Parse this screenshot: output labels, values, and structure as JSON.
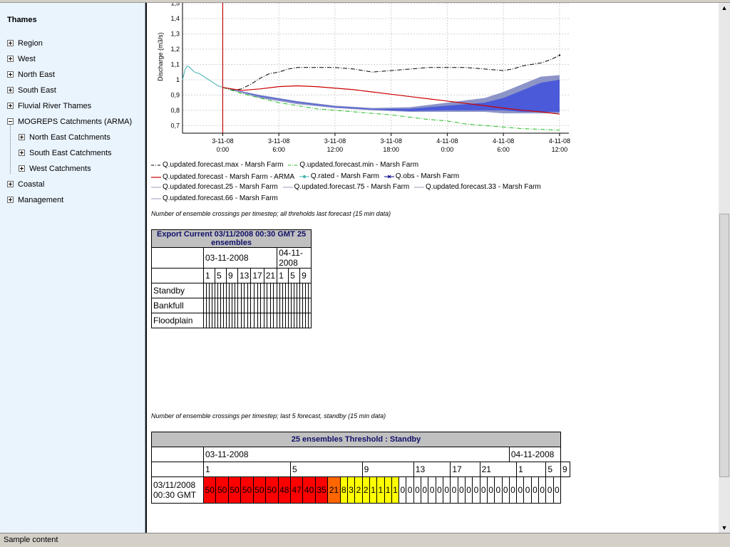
{
  "sidebar": {
    "title": "Thames",
    "items": [
      {
        "label": "Region",
        "expanded": false
      },
      {
        "label": "West",
        "expanded": false
      },
      {
        "label": "North East",
        "expanded": false
      },
      {
        "label": "South East",
        "expanded": false
      },
      {
        "label": "Fluvial River Thames",
        "expanded": false
      },
      {
        "label": "MOGREPS Catchments (ARMA)",
        "expanded": true
      },
      {
        "label": "North East Catchments",
        "expanded": false,
        "child": true
      },
      {
        "label": "South East Catchments",
        "expanded": false,
        "child": true
      },
      {
        "label": "West Catchments",
        "expanded": false,
        "child": true
      },
      {
        "label": "Coastal",
        "expanded": false
      },
      {
        "label": "Management",
        "expanded": false
      }
    ]
  },
  "status": {
    "text": "Sample content"
  },
  "chart_data": {
    "type": "line",
    "ylabel": "Discharge (m3/s)",
    "yticks": [
      "0,7",
      "0,8",
      "0,9",
      "1",
      "1,1",
      "1,2",
      "1,3",
      "1,4",
      "1,5"
    ],
    "ylim": [
      0.65,
      1.55
    ],
    "xticks": [
      {
        "date": "3-11-08",
        "time": "0:00",
        "h": 0
      },
      {
        "date": "3-11-08",
        "time": "6:00",
        "h": 6
      },
      {
        "date": "3-11-08",
        "time": "12:00",
        "h": 12
      },
      {
        "date": "3-11-08",
        "time": "18:00",
        "h": 18
      },
      {
        "date": "4-11-08",
        "time": "0:00",
        "h": 24
      },
      {
        "date": "4-11-08",
        "time": "6:00",
        "h": 30
      },
      {
        "date": "4-11-08",
        "time": "12:00",
        "h": 36
      }
    ],
    "xlim_hours": [
      -4.3,
      37
    ],
    "forecast_time_hours": 0,
    "series": [
      {
        "name": "Q.updated.forecast.max - Marsh Farm",
        "color": "#000000",
        "dash": "6,2,1,2",
        "x": [
          0,
          1,
          2,
          3,
          4,
          5,
          6,
          7,
          8,
          10,
          12,
          14,
          16,
          18,
          20,
          22,
          24,
          26,
          28,
          30,
          31,
          32,
          33,
          34,
          35,
          36
        ],
        "y": [
          0.95,
          0.93,
          0.94,
          0.97,
          1.01,
          1.04,
          1.05,
          1.07,
          1.08,
          1.08,
          1.08,
          1.07,
          1.05,
          1.06,
          1.07,
          1.08,
          1.08,
          1.08,
          1.07,
          1.06,
          1.07,
          1.09,
          1.1,
          1.11,
          1.13,
          1.16
        ]
      },
      {
        "name": "Q.updated.forecast.min - Marsh Farm",
        "color": "#22bb22",
        "dash": "6,2,1,2",
        "x": [
          0,
          2,
          4,
          6,
          8,
          10,
          12,
          14,
          16,
          18,
          20,
          22,
          24,
          26,
          28,
          30,
          32,
          34,
          36
        ],
        "y": [
          0.95,
          0.91,
          0.88,
          0.85,
          0.83,
          0.81,
          0.8,
          0.79,
          0.78,
          0.77,
          0.755,
          0.74,
          0.73,
          0.71,
          0.7,
          0.69,
          0.68,
          0.675,
          0.67
        ]
      },
      {
        "name": "Q.updated.forecast - Marsh Farm - ARMA",
        "color": "#cc0000",
        "dash": "",
        "x": [
          0,
          2,
          4,
          6,
          8,
          10,
          12,
          14,
          16,
          18,
          20,
          22,
          24,
          26,
          28,
          30,
          32,
          34,
          36
        ],
        "y": [
          0.95,
          0.93,
          0.94,
          0.955,
          0.96,
          0.955,
          0.945,
          0.935,
          0.92,
          0.905,
          0.89,
          0.875,
          0.86,
          0.845,
          0.83,
          0.815,
          0.8,
          0.79,
          0.775
        ]
      },
      {
        "name": "Q.rated - Marsh Farm",
        "color": "#40b0b0",
        "dash": "",
        "x": [
          -4.3,
          -4.0,
          -3.8,
          -3.5,
          -3.2,
          -3.0,
          -2.5,
          -2.0,
          -1.5,
          -1.0,
          -0.5,
          0
        ],
        "y": [
          1.0,
          1.07,
          1.09,
          1.08,
          1.06,
          1.05,
          1.04,
          1.02,
          1.0,
          0.98,
          0.96,
          0.95
        ]
      },
      {
        "name": "Q.obs - Marsh Farm",
        "color": "#000088",
        "dash": "",
        "x": [],
        "y": []
      },
      {
        "name": "Q.updated.forecast.25 - Marsh Farm",
        "color": "#9999bb",
        "dash": "",
        "x": [],
        "y": []
      },
      {
        "name": "Q.updated.forecast.75 - Marsh Farm",
        "color": "#9999bb",
        "dash": "",
        "x": [],
        "y": []
      },
      {
        "name": "Q.updated.forecast.33 - Marsh Farm",
        "color": "#9999bb",
        "dash": "",
        "x": [],
        "y": []
      },
      {
        "name": "Q.updated.forecast.66 - Marsh Farm",
        "color": "#9999bb",
        "dash": "",
        "x": [],
        "y": []
      }
    ],
    "band_outer": {
      "x": [
        0,
        4,
        8,
        12,
        16,
        20,
        24,
        28,
        30,
        32,
        34,
        36
      ],
      "lo": [
        0.95,
        0.88,
        0.84,
        0.815,
        0.8,
        0.79,
        0.79,
        0.79,
        0.78,
        0.78,
        0.78,
        0.78
      ],
      "hi": [
        0.95,
        0.9,
        0.86,
        0.83,
        0.815,
        0.82,
        0.85,
        0.88,
        0.92,
        0.97,
        1.02,
        1.03
      ]
    },
    "band_inner": {
      "x": [
        0,
        4,
        8,
        12,
        16,
        20,
        24,
        28,
        30,
        32,
        34,
        36
      ],
      "lo": [
        0.95,
        0.89,
        0.85,
        0.82,
        0.805,
        0.795,
        0.8,
        0.8,
        0.8,
        0.79,
        0.79,
        0.79
      ],
      "hi": [
        0.95,
        0.895,
        0.855,
        0.825,
        0.81,
        0.81,
        0.83,
        0.85,
        0.88,
        0.93,
        0.98,
        1.0
      ]
    },
    "band_colors": {
      "outer": "#8c94c8",
      "inner": "#4a5ad8"
    }
  },
  "caption1": "Number of ensemble crossings per timestep; all threholds last forecast (15 min data)",
  "table1": {
    "header": "Export Current 03/11/2008 00:30 GMT 25 ensembles",
    "date1": "03-11-2008",
    "date2": "04-11-2008",
    "hours": [
      "1",
      "5",
      "9",
      "13",
      "17",
      "21",
      "1",
      "5",
      "9"
    ],
    "rows": [
      "Standby",
      "Bankfull",
      "Floodplain"
    ]
  },
  "caption2": "Number of ensemble crossings per timestep; last 5 forecast, standby (15 min data)",
  "table2": {
    "header": "25 ensembles Threshold : Standby",
    "date1": "03-11-2008",
    "date2": "04-11-2008",
    "hours": [
      "1",
      "5",
      "9",
      "13",
      "17",
      "21",
      "1",
      "5",
      "9"
    ],
    "row_label": "03/11/2008 00:30 GMT",
    "values": [
      "50",
      "50",
      "50",
      "50",
      "50",
      "50",
      "48",
      "47",
      "40",
      "35",
      "21",
      "8",
      "3",
      "2",
      "2",
      "1",
      "1",
      "1",
      "1",
      "0",
      "0",
      "0",
      "0",
      "0",
      "0",
      "0",
      "0",
      "0",
      "0",
      "0",
      "0",
      "0",
      "0",
      "0",
      "0",
      "0",
      "0",
      "0",
      "0",
      "0",
      "0"
    ]
  }
}
